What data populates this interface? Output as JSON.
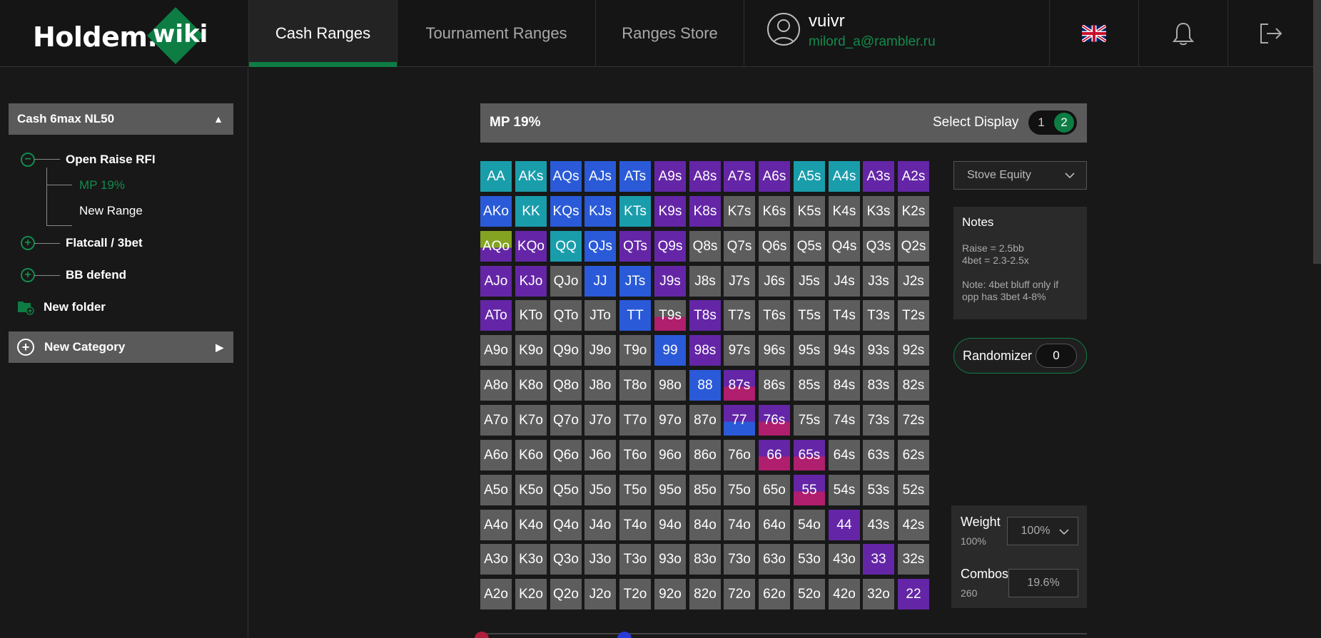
{
  "header": {
    "logo_text": "Holdem.",
    "logo_badge": "wiki",
    "tabs": [
      {
        "label": "Cash Ranges",
        "active": true
      },
      {
        "label": "Tournament Ranges",
        "active": false
      },
      {
        "label": "Ranges Store",
        "active": false
      }
    ],
    "user": {
      "name": "vuivr",
      "email": "milord_a@rambler.ru"
    },
    "icons": [
      "uk-flag-icon",
      "bell-icon",
      "logout-icon"
    ]
  },
  "sidebar": {
    "category": "Cash 6max NL50",
    "tree": {
      "group1": "Open Raise RFI",
      "group1_children": [
        {
          "label": "MP 19%",
          "active": true
        },
        {
          "label": "New Range",
          "active": false
        }
      ],
      "group2": "Flatcall / 3bet",
      "group3": "BB defend",
      "new_folder": "New folder"
    },
    "new_category": "New Category"
  },
  "panel": {
    "title": "MP 19%",
    "select_display_label": "Select Display",
    "display_options": [
      "1",
      "2"
    ],
    "display_selected": "2"
  },
  "colors": {
    "fold": "#5d5d5d",
    "teal": "#1a9dab",
    "blue": "#2a5ad8",
    "purple": "#6426a6",
    "magenta": "#b01e6e",
    "olive": "#85a322",
    "accent_green": "#0e7d44"
  },
  "range_grid": {
    "rows": [
      [
        "AA",
        "AKs",
        "AQs",
        "AJs",
        "ATs",
        "A9s",
        "A8s",
        "A7s",
        "A6s",
        "A5s",
        "A4s",
        "A3s",
        "A2s"
      ],
      [
        "AKo",
        "KK",
        "KQs",
        "KJs",
        "KTs",
        "K9s",
        "K8s",
        "K7s",
        "K6s",
        "K5s",
        "K4s",
        "K3s",
        "K2s"
      ],
      [
        "AQo",
        "KQo",
        "QQ",
        "QJs",
        "QTs",
        "Q9s",
        "Q8s",
        "Q7s",
        "Q6s",
        "Q5s",
        "Q4s",
        "Q3s",
        "Q2s"
      ],
      [
        "AJo",
        "KJo",
        "QJo",
        "JJ",
        "JTs",
        "J9s",
        "J8s",
        "J7s",
        "J6s",
        "J5s",
        "J4s",
        "J3s",
        "J2s"
      ],
      [
        "ATo",
        "KTo",
        "QTo",
        "JTo",
        "TT",
        "T9s",
        "T8s",
        "T7s",
        "T6s",
        "T5s",
        "T4s",
        "T3s",
        "T2s"
      ],
      [
        "A9o",
        "K9o",
        "Q9o",
        "J9o",
        "T9o",
        "99",
        "98s",
        "97s",
        "96s",
        "95s",
        "94s",
        "93s",
        "92s"
      ],
      [
        "A8o",
        "K8o",
        "Q8o",
        "J8o",
        "T8o",
        "98o",
        "88",
        "87s",
        "86s",
        "85s",
        "84s",
        "83s",
        "82s"
      ],
      [
        "A7o",
        "K7o",
        "Q7o",
        "J7o",
        "T7o",
        "97o",
        "87o",
        "77",
        "76s",
        "75s",
        "74s",
        "73s",
        "72s"
      ],
      [
        "A6o",
        "K6o",
        "Q6o",
        "J6o",
        "T6o",
        "96o",
        "86o",
        "76o",
        "66",
        "65s",
        "64s",
        "63s",
        "62s"
      ],
      [
        "A5o",
        "K5o",
        "Q5o",
        "J5o",
        "T5o",
        "95o",
        "85o",
        "75o",
        "65o",
        "55",
        "54s",
        "53s",
        "52s"
      ],
      [
        "A4o",
        "K4o",
        "Q4o",
        "J4o",
        "T4o",
        "94o",
        "84o",
        "74o",
        "64o",
        "54o",
        "44",
        "43s",
        "42s"
      ],
      [
        "A3o",
        "K3o",
        "Q3o",
        "J3o",
        "T3o",
        "93o",
        "83o",
        "73o",
        "63o",
        "53o",
        "43o",
        "33",
        "32s"
      ],
      [
        "A2o",
        "K2o",
        "Q2o",
        "J2o",
        "T2o",
        "92o",
        "82o",
        "72o",
        "62o",
        "52o",
        "42o",
        "32o",
        "22"
      ]
    ],
    "actions": {
      "AA": [
        "teal"
      ],
      "AKs": [
        "teal"
      ],
      "AQs": [
        "blue"
      ],
      "AJs": [
        "blue"
      ],
      "ATs": [
        "blue"
      ],
      "A9s": [
        "purple"
      ],
      "A8s": [
        "purple"
      ],
      "A7s": [
        "purple"
      ],
      "A6s": [
        "purple"
      ],
      "A5s": [
        "teal"
      ],
      "A4s": [
        "teal"
      ],
      "A3s": [
        "purple"
      ],
      "A2s": [
        "purple"
      ],
      "AKo": [
        "blue"
      ],
      "KK": [
        "teal"
      ],
      "KQs": [
        "blue"
      ],
      "KJs": [
        "blue"
      ],
      "KTs": [
        "teal"
      ],
      "K9s": [
        "purple"
      ],
      "K8s": [
        "purple"
      ],
      "AQo": [
        "olive",
        "purple"
      ],
      "KQo": [
        "purple"
      ],
      "QQ": [
        "teal"
      ],
      "QJs": [
        "blue"
      ],
      "QTs": [
        "purple"
      ],
      "Q9s": [
        "purple"
      ],
      "AJo": [
        "purple"
      ],
      "KJo": [
        "purple"
      ],
      "JJ": [
        "blue"
      ],
      "JTs": [
        "blue"
      ],
      "J9s": [
        "purple"
      ],
      "ATo": [
        "purple"
      ],
      "TT": [
        "blue"
      ],
      "T9s": [
        "fold",
        "magenta"
      ],
      "T8s": [
        "purple"
      ],
      "99": [
        "blue"
      ],
      "98s": [
        "purple"
      ],
      "88": [
        "blue"
      ],
      "87s": [
        "purple",
        "magenta"
      ],
      "77": [
        "purple",
        "blue"
      ],
      "76s": [
        "purple",
        "magenta"
      ],
      "66": [
        "purple",
        "magenta"
      ],
      "65s": [
        "purple",
        "magenta"
      ],
      "55": [
        "purple",
        "magenta"
      ],
      "44": [
        "purple"
      ],
      "33": [
        "purple"
      ],
      "22": [
        "purple"
      ]
    }
  },
  "right_panel": {
    "equity_dropdown": "Stove Equity",
    "notes_title": "Notes",
    "notes_lines": [
      "Raise = 2.5bb",
      "4bet = 2.3-2.5x",
      "",
      "Note: 4bet bluff only if",
      "opp has 3bet 4-8%"
    ],
    "randomizer_label": "Randomizer",
    "randomizer_value": "0",
    "weight_label": "Weight",
    "weight_sub": "100%",
    "weight_select": "100%",
    "combos_label": "Combos",
    "combos_sub": "260",
    "combos_field": "19.6%"
  }
}
